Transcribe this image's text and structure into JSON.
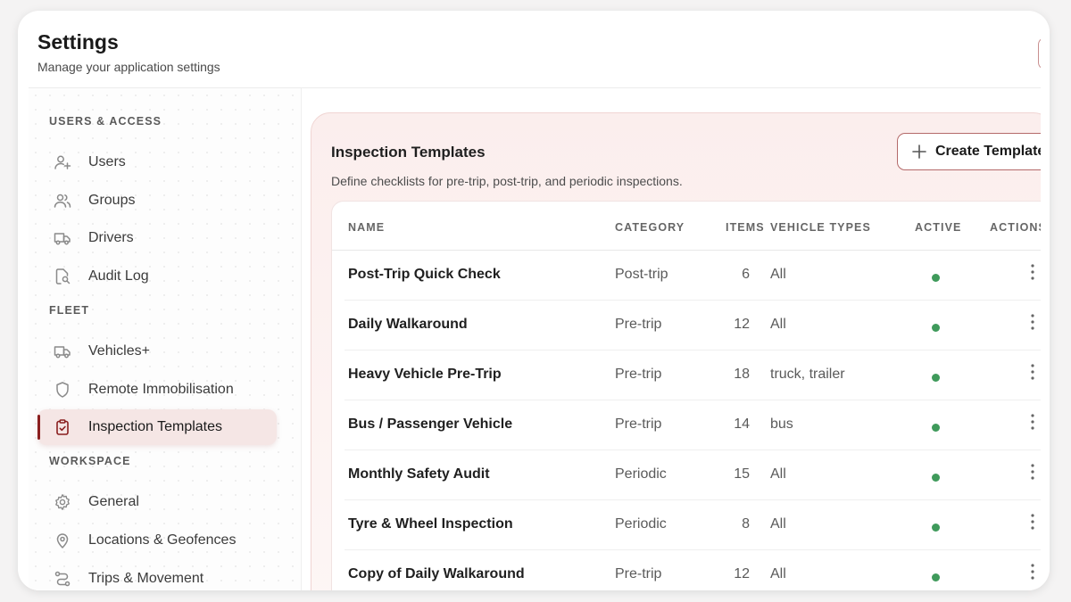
{
  "header": {
    "title": "Settings",
    "subtitle": "Manage your application settings"
  },
  "sidebar": {
    "sections": [
      {
        "label": "USERS & ACCESS"
      },
      {
        "label": "FLEET"
      },
      {
        "label": "WORKSPACE"
      }
    ],
    "items": [
      {
        "label": "Users",
        "icon": "user-plus-icon"
      },
      {
        "label": "Groups",
        "icon": "users-icon"
      },
      {
        "label": "Drivers",
        "icon": "truck-icon"
      },
      {
        "label": "Audit Log",
        "icon": "file-search-icon"
      },
      {
        "label": "Vehicles+",
        "icon": "truck-icon"
      },
      {
        "label": "Remote Immobilisation",
        "icon": "shield-icon"
      },
      {
        "label": "Inspection Templates",
        "icon": "clipboard-check-icon",
        "active": true
      },
      {
        "label": "General",
        "icon": "gear-icon"
      },
      {
        "label": "Locations & Geofences",
        "icon": "map-pin-icon"
      },
      {
        "label": "Trips & Movement",
        "icon": "route-icon"
      }
    ]
  },
  "content": {
    "title": "Inspection Templates",
    "description": "Define checklists for pre-trip, post-trip, and periodic inspections.",
    "create_label": "Create Template"
  },
  "table": {
    "columns": [
      "NAME",
      "CATEGORY",
      "ITEMS",
      "VEHICLE TYPES",
      "ACTIVE",
      "ACTIONS"
    ],
    "rows": [
      {
        "name": "Post-Trip Quick Check",
        "category": "Post-trip",
        "items": "6",
        "vehicle_types": "All",
        "active": true
      },
      {
        "name": "Daily Walkaround",
        "category": "Pre-trip",
        "items": "12",
        "vehicle_types": "All",
        "active": true
      },
      {
        "name": "Heavy Vehicle Pre-Trip",
        "category": "Pre-trip",
        "items": "18",
        "vehicle_types": "truck, trailer",
        "active": true
      },
      {
        "name": "Bus / Passenger Vehicle",
        "category": "Pre-trip",
        "items": "14",
        "vehicle_types": "bus",
        "active": true
      },
      {
        "name": "Monthly Safety Audit",
        "category": "Periodic",
        "items": "15",
        "vehicle_types": "All",
        "active": true
      },
      {
        "name": "Tyre & Wheel Inspection",
        "category": "Periodic",
        "items": "8",
        "vehicle_types": "All",
        "active": true
      },
      {
        "name": "Copy of Daily Walkaround",
        "category": "Pre-trip",
        "items": "12",
        "vehicle_types": "All",
        "active": true
      }
    ]
  },
  "colors": {
    "accent": "#8a1f1f",
    "active_bg": "#f5e6e5",
    "active_dot": "#3f9a5b"
  }
}
